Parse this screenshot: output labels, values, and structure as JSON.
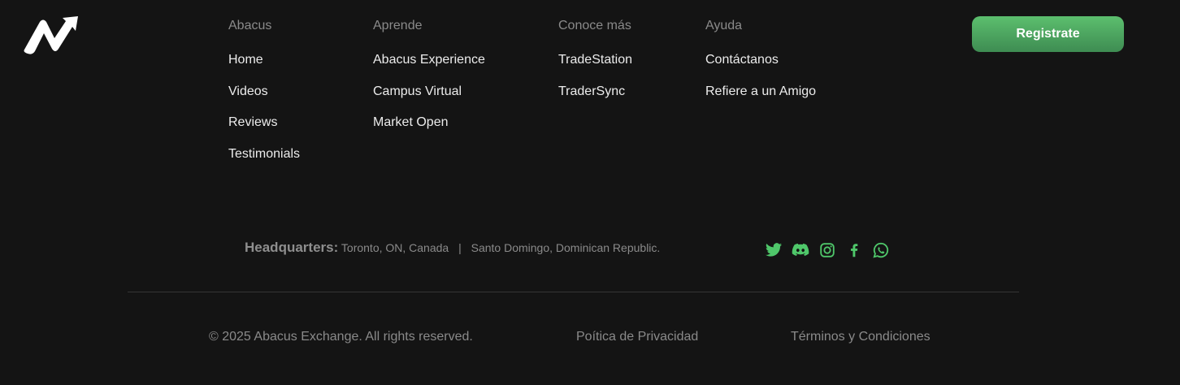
{
  "footer": {
    "columns": [
      {
        "title": "Abacus",
        "links": [
          "Home",
          "Videos",
          "Reviews",
          "Testimonials"
        ]
      },
      {
        "title": "Aprende",
        "links": [
          "Abacus Experience",
          "Campus Virtual",
          "Market Open"
        ]
      },
      {
        "title": "Conoce más",
        "links": [
          "TradeStation",
          "TraderSync"
        ]
      },
      {
        "title": "Ayuda",
        "links": [
          "Contáctanos",
          "Refiere a un Amigo"
        ]
      }
    ],
    "register_label": "Registrate",
    "hq": {
      "label": "Headquarters:",
      "location_1": "Toronto, ON, Canada",
      "separator": "|",
      "location_2": "Santo Domingo, Dominican Republic."
    },
    "social_icons": [
      "twitter-icon",
      "discord-icon",
      "instagram-icon",
      "facebook-icon",
      "whatsapp-icon"
    ],
    "copyright": "© 2025 Abacus Exchange. All rights reserved.",
    "privacy_label": "Poítica de Privacidad",
    "terms_label": "Términos y Condiciones"
  },
  "colors": {
    "background": "#141414",
    "accent_green": "#4fc76a",
    "muted_text": "#8a8a8a"
  }
}
